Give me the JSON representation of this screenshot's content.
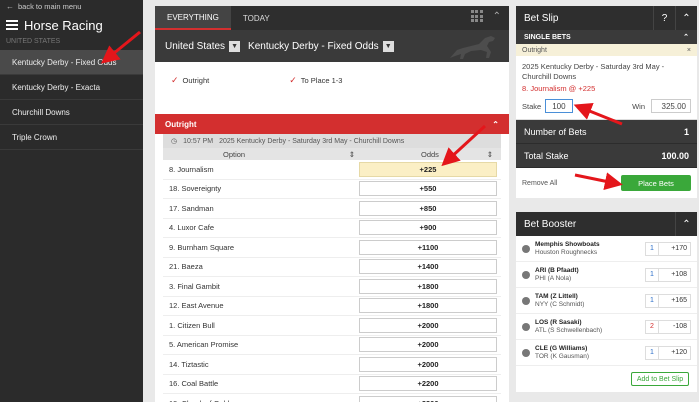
{
  "sidebar": {
    "back_label": "back to main menu",
    "title": "Horse Racing",
    "section": "UNITED STATES",
    "items": [
      {
        "label": "Kentucky Derby - Fixed Odds",
        "active": true
      },
      {
        "label": "Kentucky Derby - Exacta",
        "active": false
      },
      {
        "label": "Churchill Downs",
        "active": false
      },
      {
        "label": "Triple Crown",
        "active": false
      }
    ]
  },
  "tabs": [
    {
      "label": "EVERYTHING",
      "active": true
    },
    {
      "label": "TODAY",
      "active": false
    }
  ],
  "filters": {
    "country": "United States",
    "market": "Kentucky Derby - Fixed Odds"
  },
  "checks": [
    "Outright",
    "To Place 1-3"
  ],
  "market": {
    "title": "Outright",
    "time": "10:57 PM",
    "event": "2025 Kentucky Derby - Saturday 3rd May - Churchill Downs",
    "col_option": "Option",
    "col_odds": "Odds",
    "runners": [
      {
        "name": "8. Journalism",
        "odds": "+225",
        "selected": true
      },
      {
        "name": "18. Sovereignty",
        "odds": "+550"
      },
      {
        "name": "17. Sandman",
        "odds": "+850"
      },
      {
        "name": "4. Luxor Cafe",
        "odds": "+900"
      },
      {
        "name": "9. Burnham Square",
        "odds": "+1100"
      },
      {
        "name": "21. Baeza",
        "odds": "+1400"
      },
      {
        "name": "3. Final Gambit",
        "odds": "+1800"
      },
      {
        "name": "12. East Avenue",
        "odds": "+1800"
      },
      {
        "name": "1. Citizen Bull",
        "odds": "+2000"
      },
      {
        "name": "5. American Promise",
        "odds": "+2000"
      },
      {
        "name": "14. Tiztastic",
        "odds": "+2000"
      },
      {
        "name": "16. Coal Battle",
        "odds": "+2200"
      },
      {
        "name": "19. Chunk of Gold",
        "odds": "+3300"
      }
    ]
  },
  "betslip": {
    "title": "Bet Slip",
    "help": "?",
    "single_bets": "SINGLE BETS",
    "outright": "Outright",
    "close": "×",
    "event": "2025 Kentucky Derby - Saturday 3rd May - Churchill Downs",
    "selection": "8. Journalism @ +225",
    "stake_label": "Stake",
    "stake": "100",
    "win_label": "Win",
    "win": "325.00",
    "num_bets_label": "Number of Bets",
    "num_bets": "1",
    "total_stake_label": "Total Stake",
    "total_stake": "100.00",
    "remove_all": "Remove All",
    "place_bets": "Place Bets"
  },
  "booster": {
    "title": "Bet Booster",
    "rows": [
      {
        "t1": "Memphis Showboats",
        "t2": "Houston Roughnecks",
        "num": "1",
        "price": "+170",
        "icon": "football"
      },
      {
        "t1": "ARI (B Pfaadt)",
        "t2": "PHI (A Nola)",
        "num": "1",
        "price": "+108",
        "icon": "baseball"
      },
      {
        "t1": "TAM (Z Littell)",
        "t2": "NYY (C Schmidt)",
        "num": "1",
        "price": "+165",
        "icon": "baseball"
      },
      {
        "t1": "LOS (R Sasaki)",
        "t2": "ATL (S Schwellenbach)",
        "num": "2",
        "price": "-108",
        "icon": "baseball"
      },
      {
        "t1": "CLE (G Williams)",
        "t2": "TOR (K Gausman)",
        "num": "1",
        "price": "+120",
        "icon": "baseball"
      }
    ],
    "add_label": "Add to Bet Slip"
  },
  "colors": {
    "accent_red": "#d32f2f",
    "place_green": "#3aa83a",
    "selected_bg": "#fbefc5"
  }
}
